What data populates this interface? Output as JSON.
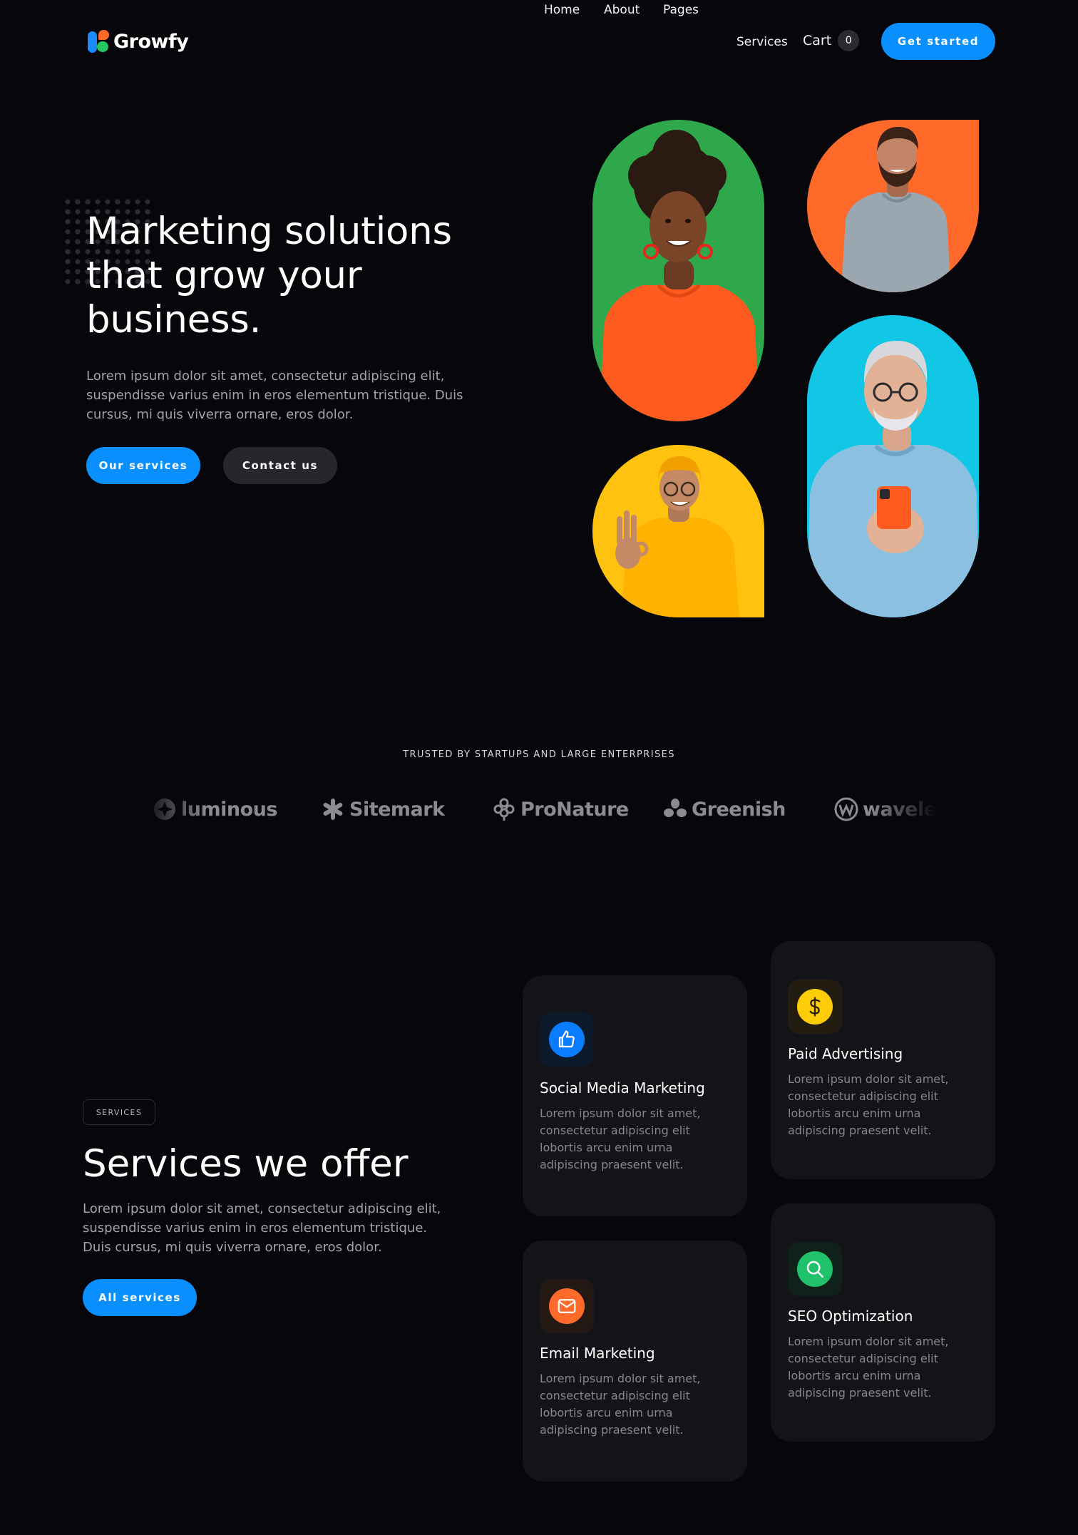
{
  "brand": {
    "name": "Growfy",
    "accent_color": "#0a8fff"
  },
  "nav": {
    "items": [
      "Home",
      "About",
      "Pages",
      "Services"
    ],
    "cart_label": "Cart",
    "cart_count": "0",
    "cta_label": "Get started"
  },
  "hero": {
    "title": "Marketing solutions that grow your business.",
    "description": "Lorem ipsum dolor sit amet, consectetur adipiscing elit, suspendisse varius enim in eros elementum tristique. Duis cursus, mi quis viverra ornare, eros dolor.",
    "primary_button": "Our services",
    "secondary_button": "Contact us",
    "portrait_backgrounds": [
      "#2ea84a",
      "#ff6a2b",
      "#ffc20e",
      "#12c6e6"
    ]
  },
  "trusted": {
    "title": "TRUSTED BY STARTUPS AND LARGE ENTERPRISES",
    "logos": [
      {
        "name": "luminous",
        "icon": "luminous-logo-icon"
      },
      {
        "name": "Sitemark",
        "icon": "sitemark-logo-icon"
      },
      {
        "name": "ProNature",
        "icon": "pronature-logo-icon"
      },
      {
        "name": "Greenish",
        "icon": "greenish-logo-icon"
      },
      {
        "name": "waveles",
        "icon": "waveless-logo-icon"
      }
    ]
  },
  "services": {
    "tag": "SERVICES",
    "title": "Services we offer",
    "description": "Lorem ipsum dolor sit amet, consectetur adipiscing elit, suspendisse varius enim in eros elementum tristique. Duis cursus, mi quis viverra ornare, eros dolor.",
    "button": "All services",
    "cards": [
      {
        "title": "Social Media Marketing",
        "text": "Lorem ipsum dolor sit amet, consectetur adipiscing elit lobortis arcu enim urna adipiscing praesent velit.",
        "icon": "thumbs-up-icon",
        "color": "#0a7cff"
      },
      {
        "title": "Paid Advertising",
        "text": "Lorem ipsum dolor sit amet, consectetur adipiscing elit lobortis arcu enim urna adipiscing praesent velit.",
        "icon": "dollar-icon",
        "color": "#ffcc0a"
      },
      {
        "title": "Email Marketing",
        "text": "Lorem ipsum dolor sit amet, consectetur adipiscing elit lobortis arcu enim urna adipiscing praesent velit.",
        "icon": "envelope-icon",
        "color": "#ff6a2b"
      },
      {
        "title": "SEO Optimization",
        "text": "Lorem ipsum dolor sit amet, consectetur adipiscing elit lobortis arcu enim urna adipiscing praesent velit.",
        "icon": "search-icon",
        "color": "#1fc16b"
      }
    ]
  }
}
